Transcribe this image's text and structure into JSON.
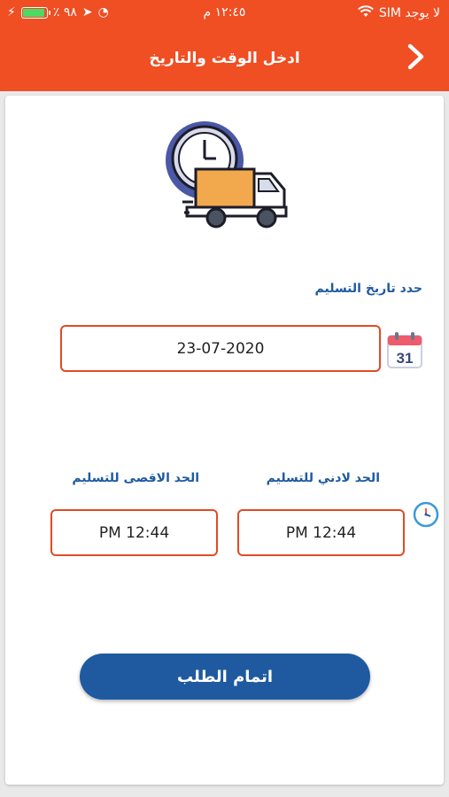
{
  "status_bar": {
    "carrier": "لا يوجد SIM",
    "time": "١٢:٤٥ م",
    "battery": "٪ ٩٨",
    "battery_level": 0.98
  },
  "header": {
    "title": "ادخل الوقت والتاريخ",
    "back_icon": "chevron-right-icon"
  },
  "date_section": {
    "label": "حدد تاريخ التسليم",
    "value": "23-07-2020",
    "icon": "calendar-icon",
    "calendar_day": "31"
  },
  "time_section": {
    "min_label": "الحد لادني للتسليم",
    "max_label": "الحد الاقصى للتسليم",
    "min_value": "PM 12:44",
    "max_value": "PM 12:44",
    "icon": "clock-icon"
  },
  "submit_button": {
    "label": "اتمام الطلب"
  },
  "colors": {
    "header": "#f04e23",
    "accent_blue": "#1f5aa0",
    "input_border": "#e14a26"
  }
}
